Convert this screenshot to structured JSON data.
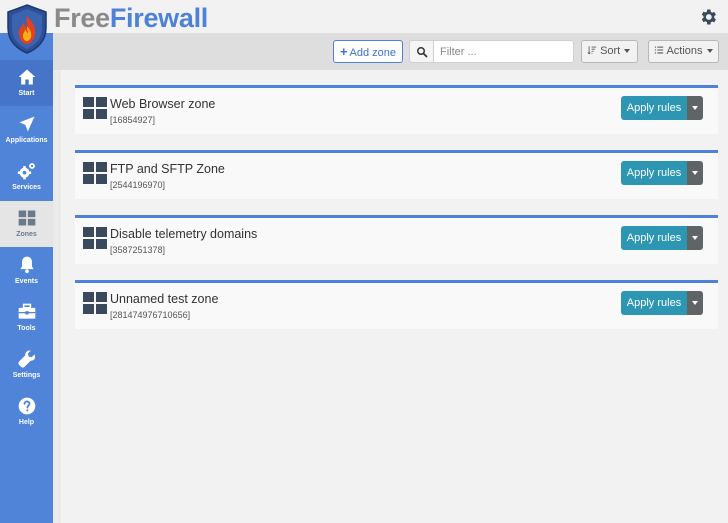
{
  "app": {
    "title_part1": "Free",
    "title_part2": "Firewall"
  },
  "sidebar": {
    "items": [
      {
        "label": "Start",
        "icon": "home-icon"
      },
      {
        "label": "Applications",
        "icon": "paper-plane-icon"
      },
      {
        "label": "Services",
        "icon": "cogs-icon"
      },
      {
        "label": "Zones",
        "icon": "zones-grid-icon"
      },
      {
        "label": "Events",
        "icon": "bell-icon"
      },
      {
        "label": "Tools",
        "icon": "toolbox-icon"
      },
      {
        "label": "Settings",
        "icon": "wrench-icon"
      },
      {
        "label": "Help",
        "icon": "help-icon"
      }
    ]
  },
  "toolbar": {
    "add_label": "Add zone",
    "search_placeholder": "Filter ...",
    "sort_label": "Sort",
    "actions_label": "Actions"
  },
  "zones": [
    {
      "name": "Web Browser zone",
      "id": "[16854927]",
      "apply_label": "Apply rules"
    },
    {
      "name": "FTP and SFTP Zone",
      "id": "[2544196970]",
      "apply_label": "Apply rules"
    },
    {
      "name": "Disable telemetry domains",
      "id": "[3587251378]",
      "apply_label": "Apply rules"
    },
    {
      "name": "Unnamed test zone",
      "id": "[281474976710656]",
      "apply_label": "Apply rules"
    }
  ],
  "colors": {
    "accent": "#4e82d6",
    "sidebar": "#4f84d9",
    "apply": "#2d96b2"
  }
}
